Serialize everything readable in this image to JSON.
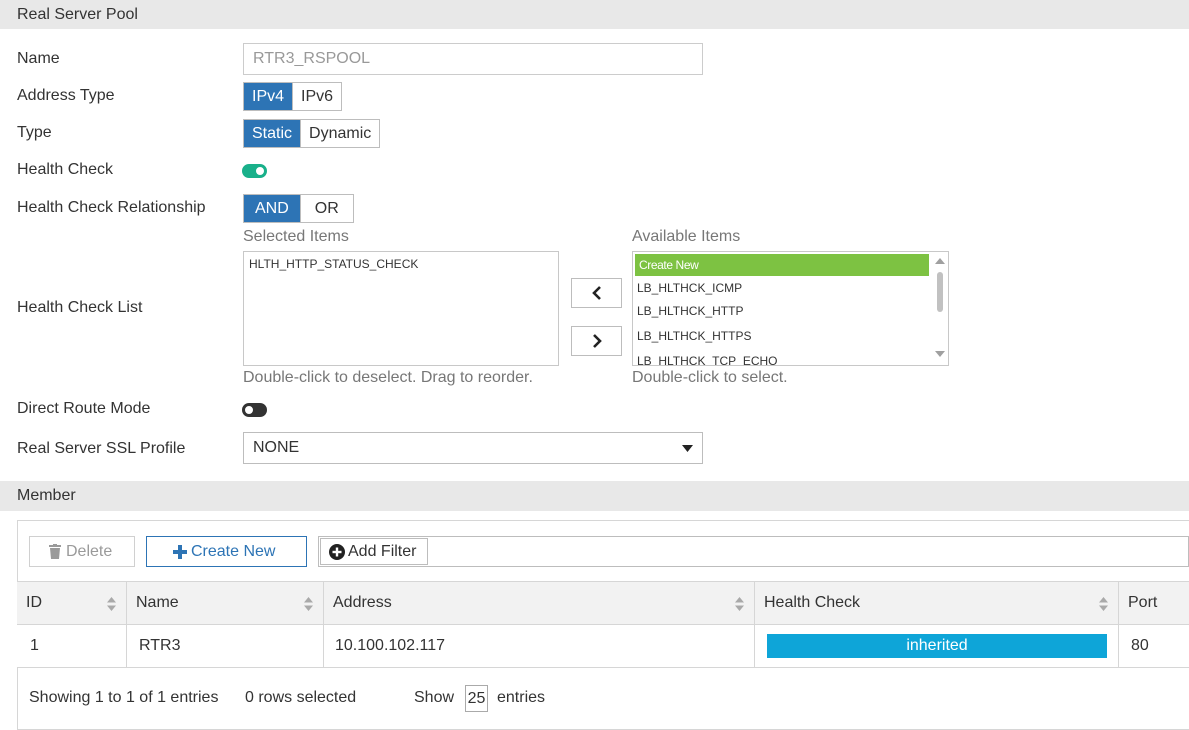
{
  "sections": {
    "real_server_pool": "Real Server Pool",
    "member": "Member"
  },
  "form": {
    "name_label": "Name",
    "name_value": "RTR3_RSPOOL",
    "address_type_label": "Address Type",
    "address_type_options": [
      "IPv4",
      "IPv6"
    ],
    "address_type_selected": "IPv4",
    "type_label": "Type",
    "type_options": [
      "Static",
      "Dynamic"
    ],
    "type_selected": "Static",
    "health_check_label": "Health Check",
    "health_check_enabled": true,
    "health_check_relationship_label": "Health Check Relationship",
    "relationship_options": [
      "AND",
      "OR"
    ],
    "relationship_selected": "AND",
    "health_check_list_label": "Health Check List",
    "selected_items_label": "Selected Items",
    "selected_items": [
      "HLTH_HTTP_STATUS_CHECK"
    ],
    "selected_hint": "Double-click to deselect. Drag to reorder.",
    "available_items_label": "Available Items",
    "available_create_new": "Create New",
    "available_items": [
      "LB_HLTHCK_ICMP",
      "LB_HLTHCK_HTTP",
      "LB_HLTHCK_HTTPS",
      "LB_HLTHCK_TCP_ECHO"
    ],
    "available_hint": "Double-click to select.",
    "direct_route_mode_label": "Direct Route Mode",
    "direct_route_mode_enabled": false,
    "ssl_profile_label": "Real Server SSL Profile",
    "ssl_profile_value": "NONE"
  },
  "member_toolbar": {
    "delete_label": "Delete",
    "create_new_label": "Create New",
    "add_filter_label": "Add Filter"
  },
  "table": {
    "columns": [
      "ID",
      "Name",
      "Address",
      "Health Check",
      "Port"
    ],
    "rows": [
      {
        "id": "1",
        "name": "RTR3",
        "address": "10.100.102.117",
        "health_check": "inherited",
        "port": "80"
      }
    ]
  },
  "footer": {
    "showing": "Showing 1 to 1 of 1 entries",
    "rows_selected": "0 rows selected",
    "show_label": "Show",
    "page_size": "25",
    "entries_label": "entries"
  },
  "colors": {
    "accent_blue": "#2d74b5",
    "toggle_on": "#19b08a",
    "create_new_green": "#7dc242",
    "badge_blue": "#0ea5d8"
  }
}
